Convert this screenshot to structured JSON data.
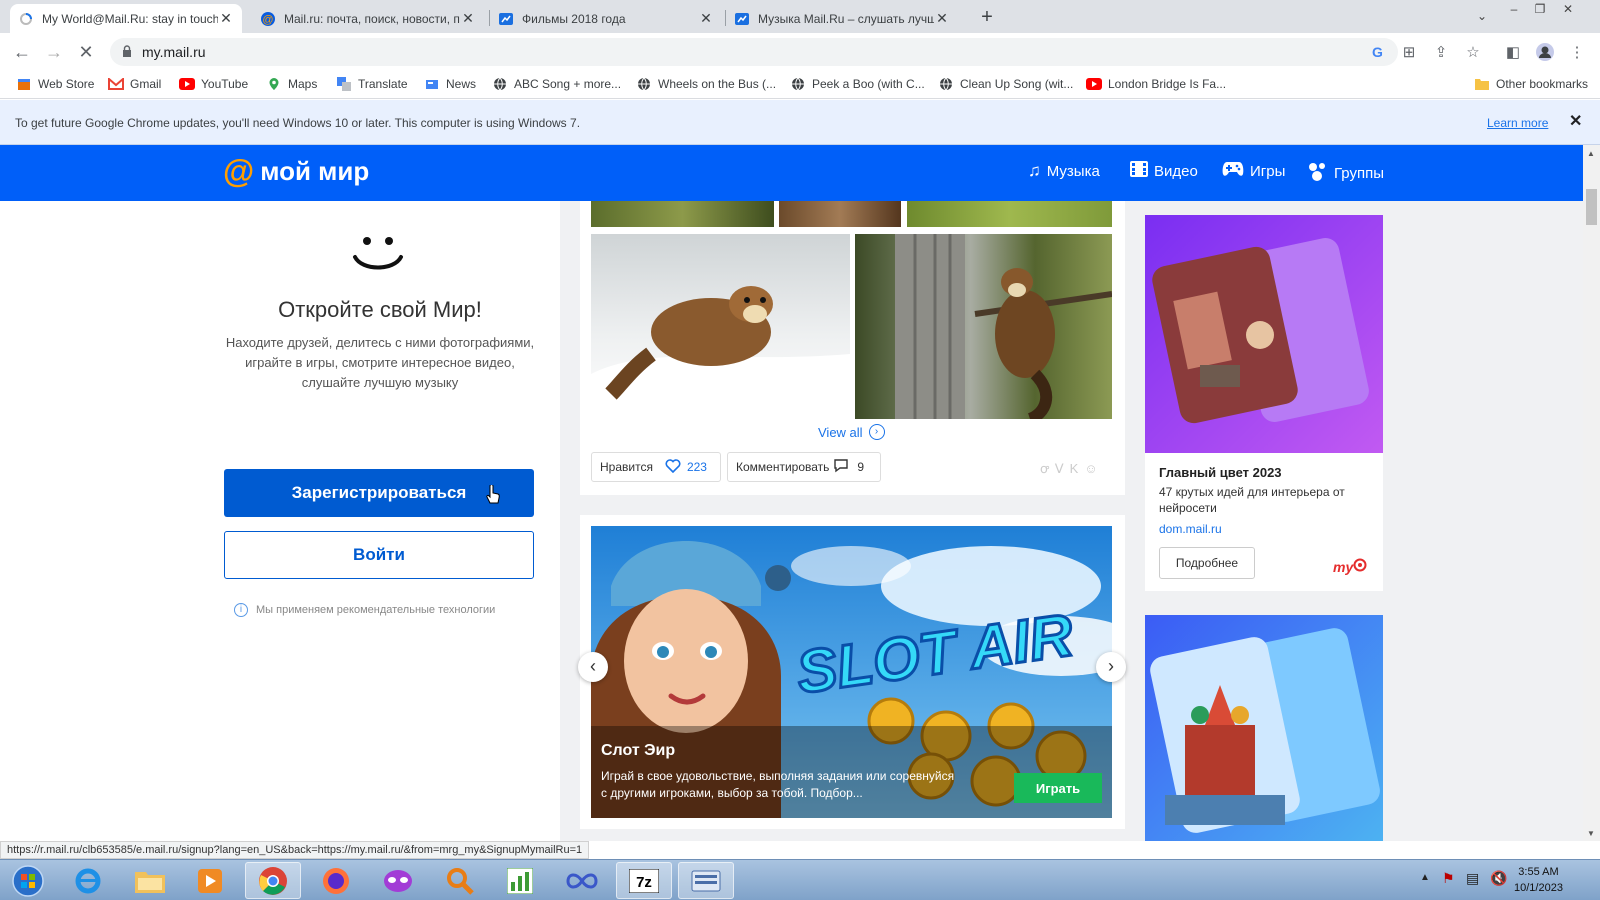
{
  "browser": {
    "tabs": [
      {
        "title": "My World@Mail.Ru: stay in touch",
        "active": true,
        "icon": "loading-spinner-icon"
      },
      {
        "title": "Mail.ru: почта, поиск, новости, п",
        "active": false,
        "icon": "mailru-at-icon"
      },
      {
        "title": "Фильмы 2018 года",
        "active": false,
        "icon": "video-icon"
      },
      {
        "title": "Музыка Mail.Ru – слушать лучш",
        "active": false,
        "icon": "music-icon"
      }
    ],
    "url": "my.mail.ru",
    "bookmarks": [
      {
        "label": "Web Store",
        "icon": "web-store-icon"
      },
      {
        "label": "Gmail",
        "icon": "gmail-icon"
      },
      {
        "label": "YouTube",
        "icon": "youtube-icon"
      },
      {
        "label": "Maps",
        "icon": "maps-icon"
      },
      {
        "label": "Translate",
        "icon": "translate-icon"
      },
      {
        "label": "News",
        "icon": "news-icon"
      },
      {
        "label": "ABC Song + more...",
        "icon": "globe-icon"
      },
      {
        "label": "Wheels on the Bus (...",
        "icon": "globe-icon"
      },
      {
        "label": "Peek a Boo (with C...",
        "icon": "globe-icon"
      },
      {
        "label": "Clean Up Song (wit...",
        "icon": "globe-icon"
      },
      {
        "label": "London Bridge Is Fa...",
        "icon": "youtube-icon"
      }
    ],
    "other_bookmarks": "Other bookmarks",
    "infobar": {
      "message": "To get future Google Chrome updates, you'll need Windows 10 or later. This computer is using Windows 7.",
      "learn_more": "Learn more"
    },
    "status_url": "https://r.mail.ru/clb653585/e.mail.ru/signup?lang=en_US&back=https://my.mail.ru/&from=mrg_my&SignupMymailRu=1"
  },
  "site": {
    "logo_at": "@",
    "logo_text": "мой мир",
    "nav": [
      {
        "label": "Музыка",
        "icon": "music-note-icon"
      },
      {
        "label": "Видео",
        "icon": "film-icon"
      },
      {
        "label": "Игры",
        "icon": "gamepad-icon"
      },
      {
        "label": "Группы",
        "icon": "groups-icon"
      }
    ],
    "promo": {
      "title": "Откройте свой Мир!",
      "description": "Находите друзей, делитесь с ними фотографиями, играйте в игры, смотрите интересное видео, слушайте лучшую музыку",
      "register_label": "Зарегистрироваться",
      "login_label": "Войти",
      "recommendation_note": "Мы применяем рекомендательные технологии"
    },
    "post": {
      "view_all": "View all",
      "like_label": "Нравится",
      "like_count": "223",
      "comment_label": "Комментировать",
      "comment_count": "9"
    },
    "game_banner": {
      "logo_text": "SLOT AIR",
      "title": "Слот Эир",
      "description": "Играй в свое удовольствие, выполняя задания или соревнуйся с другими игроками, выбор за тобой. Подбор...",
      "play_label": "Играть"
    },
    "ad": {
      "title": "Главный цвет 2023",
      "description": "47 крутых идей для интерьера от нейросети",
      "domain": "dom.mail.ru",
      "button_label": "Подробнее",
      "logo": "my"
    }
  },
  "taskbar": {
    "time": "3:55 AM",
    "date": "10/1/2023"
  }
}
